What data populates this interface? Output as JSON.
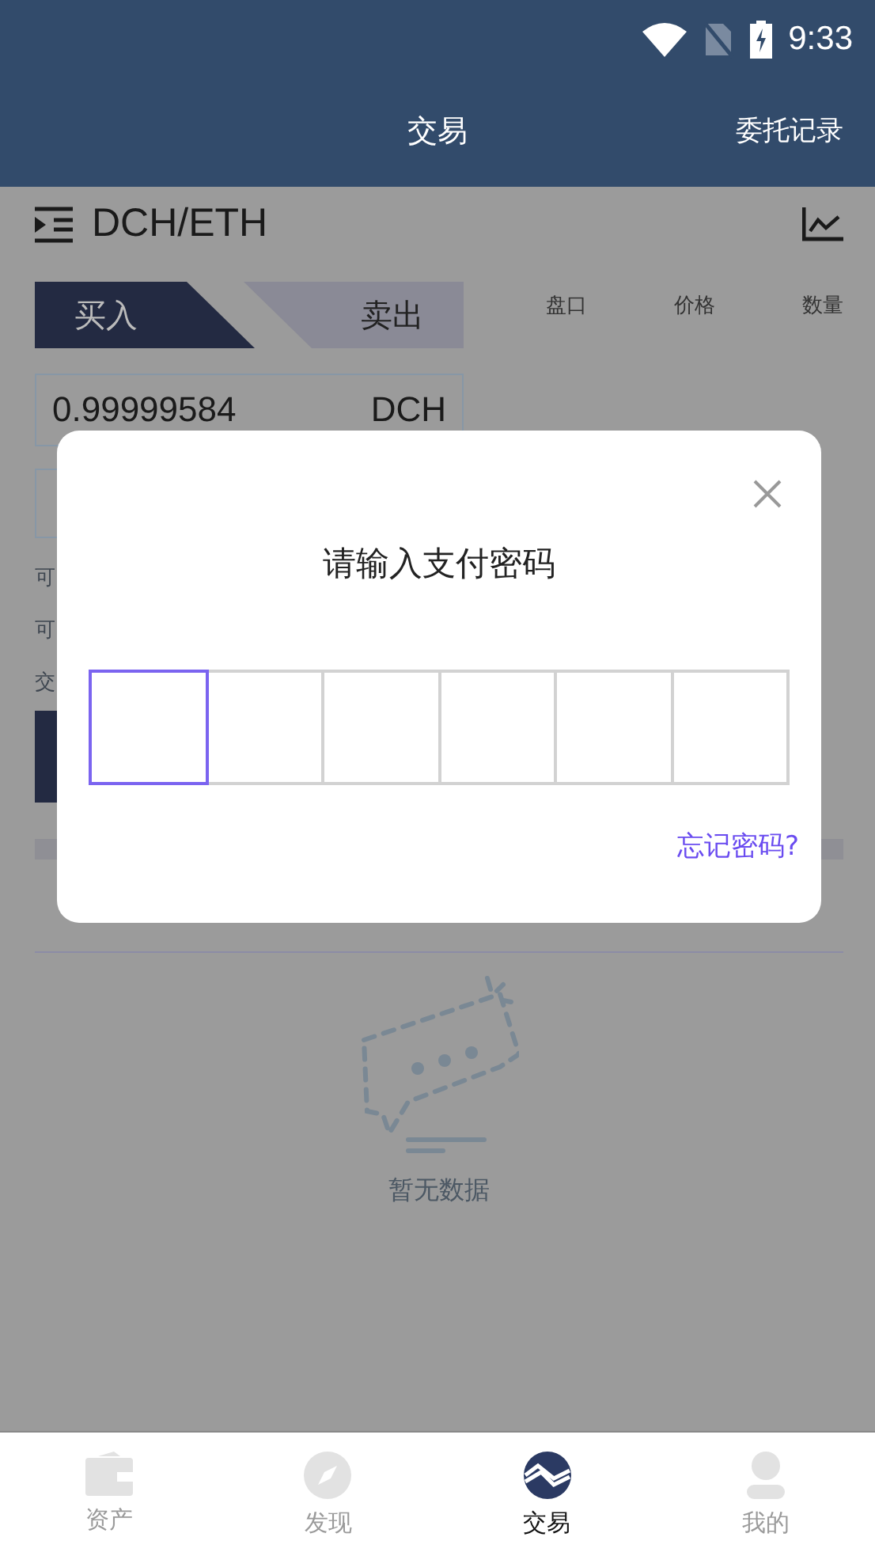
{
  "status_bar": {
    "time": "9:33"
  },
  "header": {
    "title": "交易",
    "action": "委托记录"
  },
  "pair": {
    "name": "DCH/ETH"
  },
  "trade_tabs": [
    {
      "label": "买入",
      "selected": true
    },
    {
      "label": "卖出",
      "selected": false
    }
  ],
  "order_book": {
    "columns": [
      "盘口",
      "价格",
      "数量"
    ]
  },
  "amount_field": {
    "value": "0.99999584",
    "unit": "DCH"
  },
  "side_labels": [
    "可",
    "可",
    "交"
  ],
  "empty_state": {
    "text": "暂无数据"
  },
  "dialog": {
    "title": "请输入支付密码",
    "pin_boxes": [
      {
        "focused": true
      },
      {
        "focused": false
      },
      {
        "focused": false
      },
      {
        "focused": false
      },
      {
        "focused": false
      },
      {
        "focused": false
      }
    ],
    "link": "忘记密码?"
  },
  "bottom_nav": [
    {
      "label": "资产",
      "selected": false
    },
    {
      "label": "发现",
      "selected": false
    },
    {
      "label": "交易",
      "selected": true
    },
    {
      "label": "我的",
      "selected": false
    }
  ]
}
